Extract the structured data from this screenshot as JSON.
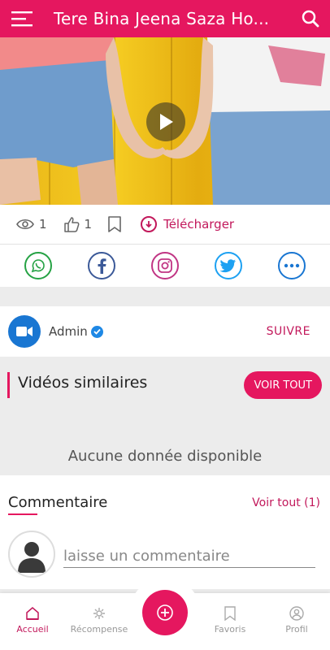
{
  "header": {
    "title": "Tere Bina Jeena Saza Ho...",
    "menu_icon": "hamburger-menu-icon",
    "search_icon": "search-icon",
    "color": "#e5175f"
  },
  "video": {
    "play_icon": "play-icon"
  },
  "stats": {
    "views": "1",
    "likes": "1",
    "download_label": "Télécharger"
  },
  "share": {
    "items": [
      "whatsapp-icon",
      "facebook-icon",
      "instagram-icon",
      "twitter-icon",
      "more-icon"
    ]
  },
  "channel": {
    "name": "Admin",
    "follow_label": "SUIVRE"
  },
  "similar": {
    "title": "Vidéos similaires",
    "see_all_label": "VOIR TOUT",
    "empty_text": "Aucune donnée disponible"
  },
  "comments": {
    "title": "Commentaire",
    "see_all_label": "Voir tout (1)",
    "input_placeholder": "laisse un commentaire"
  },
  "bottom_nav": {
    "items": [
      {
        "label": "Accueil",
        "active": true
      },
      {
        "label": "Récompense",
        "active": false
      },
      {
        "label": "Favoris",
        "active": false
      },
      {
        "label": "Profil",
        "active": false
      }
    ]
  }
}
